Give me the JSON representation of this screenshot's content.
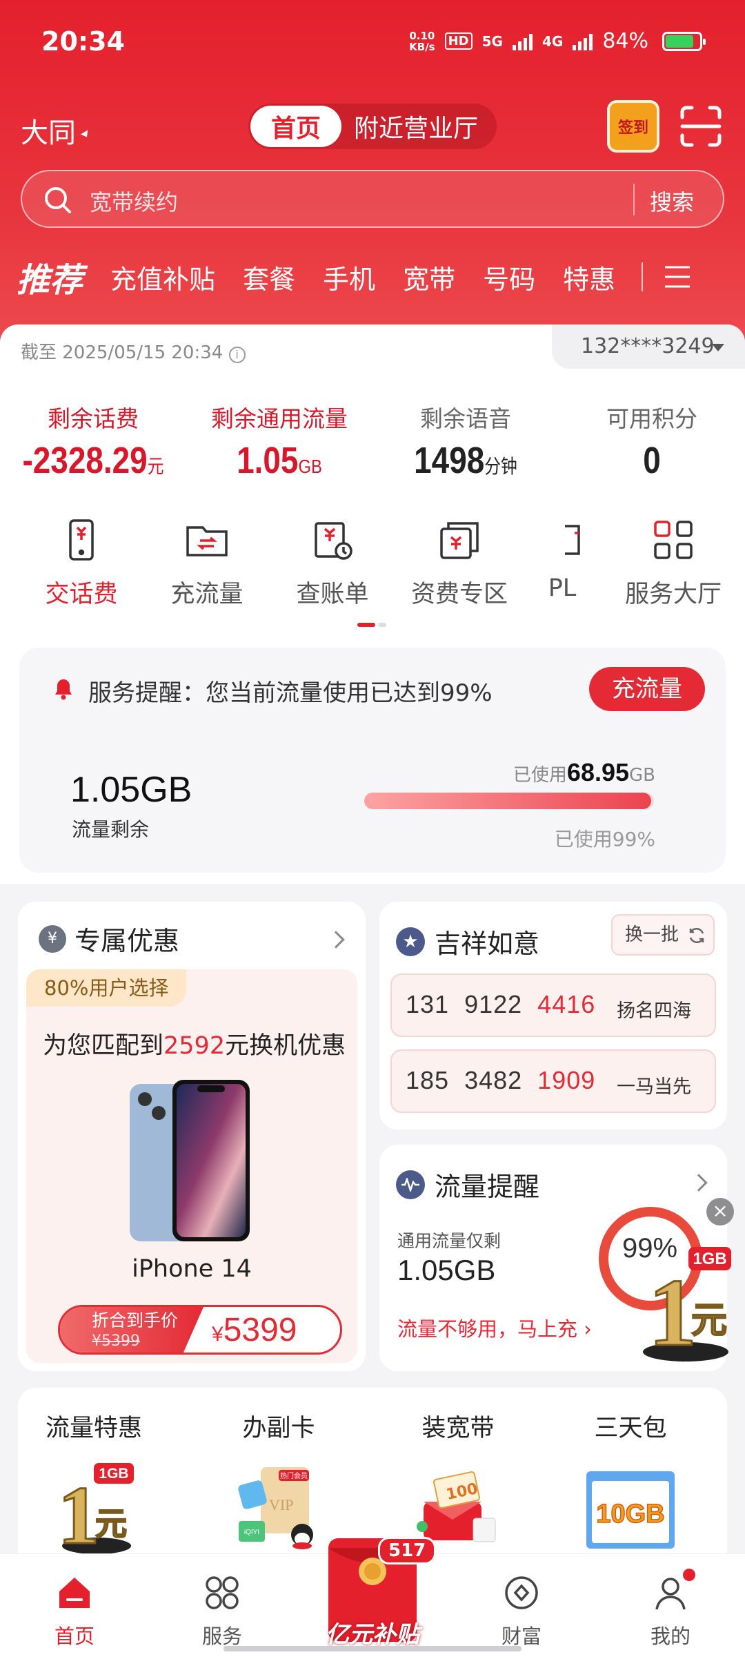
{
  "status": {
    "time": "20:34",
    "speed_top": "0.10",
    "speed_bottom": "KB/s",
    "hd": "HD",
    "net1": "5G",
    "net2": "4G",
    "battery_pct": "84%",
    "battery_level": 0.84
  },
  "header": {
    "city": "大同",
    "tab_home": "首页",
    "tab_nearby": "附近营业厅",
    "signin": "签到"
  },
  "search": {
    "placeholder": "宽带续约",
    "button": "搜索"
  },
  "categories": {
    "current": "推荐",
    "items": [
      "充值补贴",
      "套餐",
      "手机",
      "宽带",
      "号码",
      "特惠"
    ]
  },
  "account": {
    "as_of": "截至 2025/05/15 20:34",
    "phone": "132****3249"
  },
  "balances": [
    {
      "label": "剩余话费",
      "value": "-2328.29",
      "unit": "元"
    },
    {
      "label": "剩余通用流量",
      "value": "1.05",
      "unit": "GB"
    },
    {
      "label": "剩余语音",
      "value": "1498",
      "unit": "分钟"
    },
    {
      "label": "可用积分",
      "value": "0",
      "unit": ""
    }
  ],
  "shortcuts": [
    "交话费",
    "充流量",
    "查账单",
    "资费专区",
    "PL",
    "服务大厅"
  ],
  "alert": {
    "message": "服务提醒：您当前流量使用已达到99%",
    "cta": "充流量",
    "remain_value": "1.05GB",
    "remain_label": "流量剩余",
    "used_prefix": "已使用",
    "used_value": "68.95",
    "used_unit": "GB",
    "used_pct": "已使用99%",
    "used_fraction": 0.99
  },
  "promo": {
    "title": "专属优惠",
    "tag": "80%用户选择",
    "match_prefix": "为您匹配到",
    "match_amount": "2592",
    "match_suffix": "元换机优惠",
    "product": "iPhone 14",
    "price_label": "折合到手价",
    "orig_price": "¥5399",
    "price_symbol": "¥",
    "price": "5399"
  },
  "lucky": {
    "title": "吉祥如意",
    "swap": "换一批",
    "numbers": [
      {
        "head": "131  9122  ",
        "tail": "4416",
        "desc": "扬名四海"
      },
      {
        "head": "185  3482  ",
        "tail": "1909",
        "desc": "一马当先"
      }
    ]
  },
  "flow": {
    "title": "流量提醒",
    "line1": "通用流量仅剩",
    "line2": "1.05GB",
    "line3": "流量不够用，马上充",
    "ring_text": "99%",
    "promo_1": "1",
    "promo_gb": "1GB",
    "promo_yuan": "元"
  },
  "quick": [
    {
      "label": "流量特惠",
      "art_text": "1",
      "art_sub": "1GB",
      "art_yuan": "元"
    },
    {
      "label": "办副卡",
      "art_text": "VIP",
      "art_tag": "热门会员",
      "art_sub": "iQIYI"
    },
    {
      "label": "装宽带",
      "art_text": "100"
    },
    {
      "label": "三天包",
      "art_text": "10GB"
    }
  ],
  "tabbar": {
    "home": "首页",
    "service": "服务",
    "env_text": "亿元补贴",
    "env_badge": "517",
    "wealth": "财富",
    "mine": "我的"
  },
  "colors": {
    "brand": "#e4202d",
    "accent_light": "#fdf1f0"
  }
}
